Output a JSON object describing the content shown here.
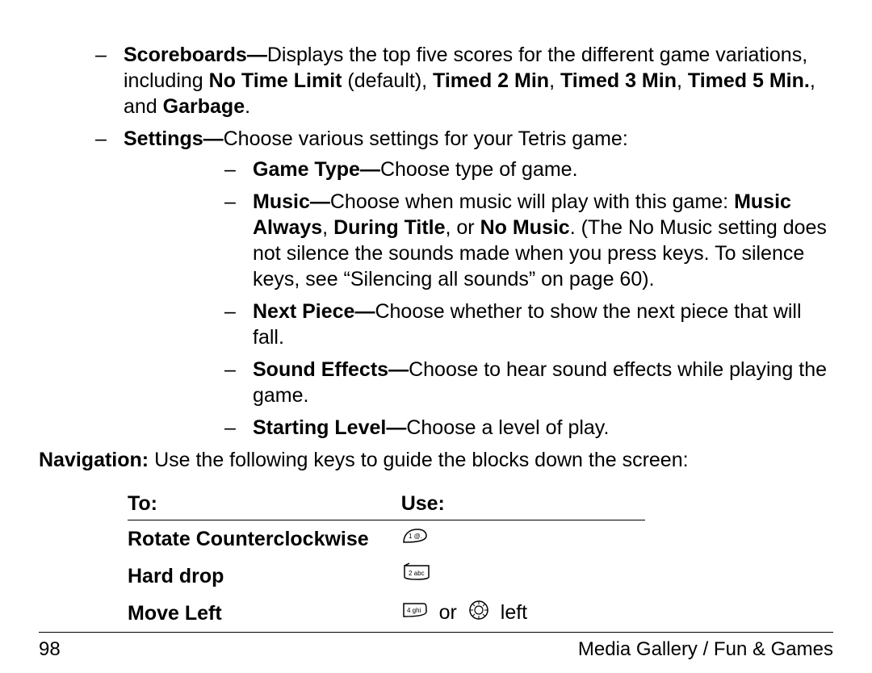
{
  "bullets": {
    "scoreboards": {
      "head": "Scoreboards—",
      "t1": "Displays the top five scores for the different game variations, including ",
      "b1": "No Time Limit",
      "t2": " (default), ",
      "b2": "Timed 2 Min",
      "t3": ", ",
      "b3": "Timed 3 Min",
      "t4": ", ",
      "b4": "Timed 5 Min.",
      "t5": ", and ",
      "b5": "Garbage",
      "t6": "."
    },
    "settings": {
      "head": "Settings—",
      "text": "Choose various settings for your Tetris game:",
      "sub": {
        "gametype": {
          "head": "Game Type—",
          "text": "Choose type of game."
        },
        "music": {
          "head": "Music—",
          "t1": "Choose when music will play with this game: ",
          "b1": "Music Always",
          "t2": ", ",
          "b2": "During Title",
          "t3": ", or ",
          "b3": "No Music",
          "t4": ". (The No Music setting does not silence the sounds made when you press keys. To silence keys, see “Silencing all sounds” on page 60)."
        },
        "nextpiece": {
          "head": "Next Piece—",
          "text": "Choose whether to show the next piece that will fall."
        },
        "soundeffects": {
          "head": "Sound Effects—",
          "text": "Choose to hear sound effects while playing the game."
        },
        "startinglevel": {
          "head": "Starting Level—",
          "text": "Choose a level of play."
        }
      }
    }
  },
  "navigation": {
    "head": "Navigation:",
    "text": "Use the following keys to guide the blocks down the screen:"
  },
  "table": {
    "head_to": "To:",
    "head_use": "Use:",
    "rows": [
      {
        "action": "Rotate Counterclockwise",
        "use_type": "key1"
      },
      {
        "action": "Hard drop",
        "use_type": "key2"
      },
      {
        "action": "Move Left",
        "use_type": "key4_nav",
        "or": "or",
        "suffix": "left"
      }
    ]
  },
  "footer": {
    "page": "98",
    "section": "Media Gallery / Fun & Games"
  }
}
